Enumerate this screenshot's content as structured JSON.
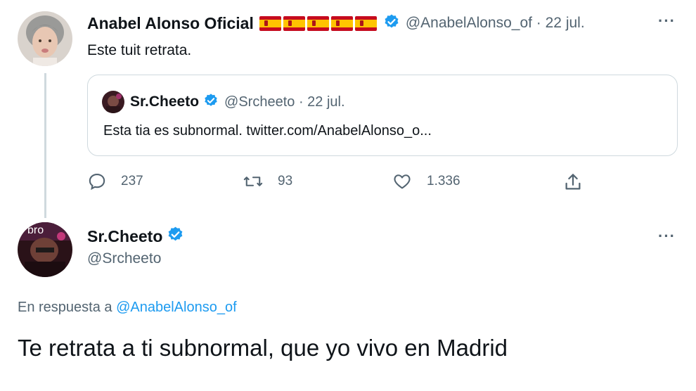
{
  "colors": {
    "accent": "#1d9bf0",
    "muted": "#536471",
    "border": "#cfd9de"
  },
  "tweet1": {
    "author_name": "Anabel Alonso Oficial",
    "flags": [
      "es-flag",
      "es-flag",
      "es-flag",
      "es-flag",
      "es-flag"
    ],
    "handle_date": "@AnabelAlonso_of · 22 jul.",
    "text": "Este tuit retrata.",
    "quote": {
      "author_name": "Sr.Cheeto",
      "handle_date": "@Srcheeto · 22 jul.",
      "text": "Esta tia es subnormal. twitter.com/AnabelAlonso_o..."
    },
    "actions": {
      "replies": "237",
      "retweets": "93",
      "likes": "1.336"
    }
  },
  "tweet2": {
    "author_name": "Sr.Cheeto",
    "handle": "@Srcheeto",
    "avatar_text": "bro",
    "reply_prefix": "En respuesta a",
    "reply_to": "@AnabelAlonso_of",
    "text": "Te retrata a ti subnormal, que yo vivo en Madrid"
  }
}
